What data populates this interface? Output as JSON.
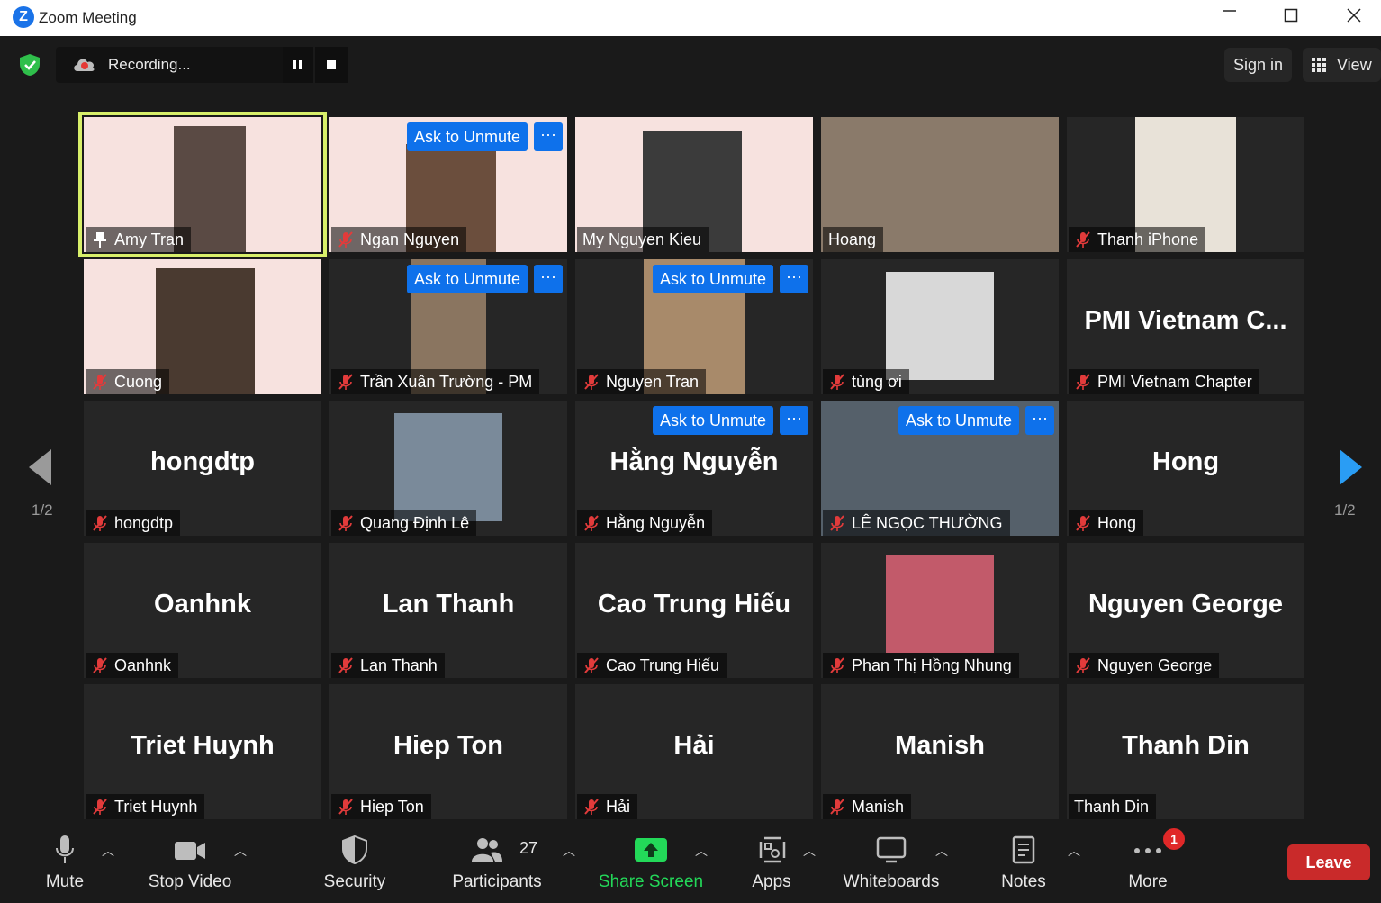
{
  "window": {
    "title": "Zoom Meeting",
    "logo_letter": "Z"
  },
  "recording": {
    "text": "Recording..."
  },
  "topbar": {
    "signin": "Sign in",
    "view": "View"
  },
  "pager": {
    "left": "1/2",
    "right": "1/2"
  },
  "ask_label": "Ask to Unmute",
  "more_dots": "···",
  "tiles": [
    {
      "label": "Amy Tran",
      "big": ""
    },
    {
      "label": "Ngan Nguyen",
      "big": ""
    },
    {
      "label": "My Nguyen Kieu",
      "big": ""
    },
    {
      "label": "Hoang",
      "big": ""
    },
    {
      "label": "Thanh iPhone",
      "big": ""
    },
    {
      "label": "Cuong",
      "big": ""
    },
    {
      "label": "Trần Xuân Trường - PM",
      "big": ""
    },
    {
      "label": "Nguyen Tran",
      "big": ""
    },
    {
      "label": "tùng ơi",
      "big": ""
    },
    {
      "label": "PMI Vietnam Chapter",
      "big": "PMI  Vietnam  C..."
    },
    {
      "label": "hongdtp",
      "big": "hongdtp"
    },
    {
      "label": "Quang Định Lê",
      "big": ""
    },
    {
      "label": "Hằng Nguyễn",
      "big": "Hằng Nguyễn"
    },
    {
      "label": "LÊ NGỌC THƯỜNG",
      "big": ""
    },
    {
      "label": "Hong",
      "big": "Hong"
    },
    {
      "label": "Oanhnk",
      "big": "Oanhnk"
    },
    {
      "label": "Lan Thanh",
      "big": "Lan Thanh"
    },
    {
      "label": "Cao Trung Hiếu",
      "big": "Cao Trung Hiếu"
    },
    {
      "label": "Phan Thị Hồng Nhung",
      "big": ""
    },
    {
      "label": "Nguyen George",
      "big": "Nguyen George"
    },
    {
      "label": "Triet Huynh",
      "big": "Triet Huynh"
    },
    {
      "label": "Hiep Ton",
      "big": "Hiep Ton"
    },
    {
      "label": "Hải",
      "big": "Hải"
    },
    {
      "label": "Manish",
      "big": "Manish"
    },
    {
      "label": "Thanh Din",
      "big": "Thanh Din"
    }
  ],
  "toolbar": {
    "mute": "Mute",
    "stop_video": "Stop Video",
    "security": "Security",
    "participants": "Participants",
    "participants_count": "27",
    "share_screen": "Share Screen",
    "apps": "Apps",
    "whiteboards": "Whiteboards",
    "notes": "Notes",
    "more": "More",
    "more_badge": "1",
    "leave": "Leave"
  },
  "colors": {
    "accent_blue": "#0e71eb",
    "share_green": "#23d959",
    "leave_red": "#c92a2a",
    "active_speaker": "#d8ef6a"
  }
}
